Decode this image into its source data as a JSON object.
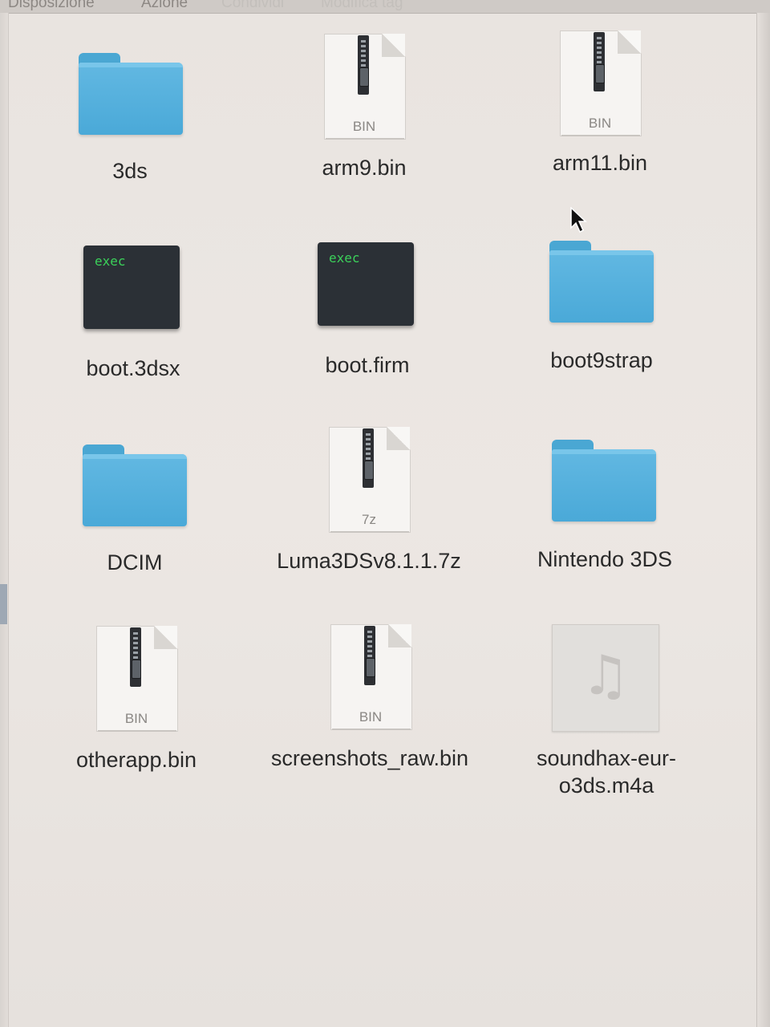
{
  "toolbar": {
    "items": [
      "Disposizione",
      "Azione",
      "Condividi",
      "Modifica tag"
    ]
  },
  "files": [
    {
      "name": "3ds",
      "kind": "folder"
    },
    {
      "name": "arm9.bin",
      "kind": "bin",
      "ext": "BIN"
    },
    {
      "name": "arm11.bin",
      "kind": "bin",
      "ext": "BIN"
    },
    {
      "name": "boot.3dsx",
      "kind": "exec",
      "code": "exec"
    },
    {
      "name": "boot.firm",
      "kind": "exec",
      "code": "exec"
    },
    {
      "name": "boot9strap",
      "kind": "folder"
    },
    {
      "name": "DCIM",
      "kind": "folder"
    },
    {
      "name": "Luma3DSv8.1.1.7z",
      "kind": "archive",
      "ext": "7z"
    },
    {
      "name": "Nintendo 3DS",
      "kind": "folder"
    },
    {
      "name": "otherapp.bin",
      "kind": "bin",
      "ext": "BIN"
    },
    {
      "name": "screenshots_raw.bin",
      "kind": "bin",
      "ext": "BIN"
    },
    {
      "name": "soundhax-eur-o3ds.m4a",
      "kind": "audio"
    }
  ],
  "colors": {
    "folder": "#4aa9d8",
    "exec_bg": "#2b3036",
    "exec_text": "#3bd15a"
  }
}
